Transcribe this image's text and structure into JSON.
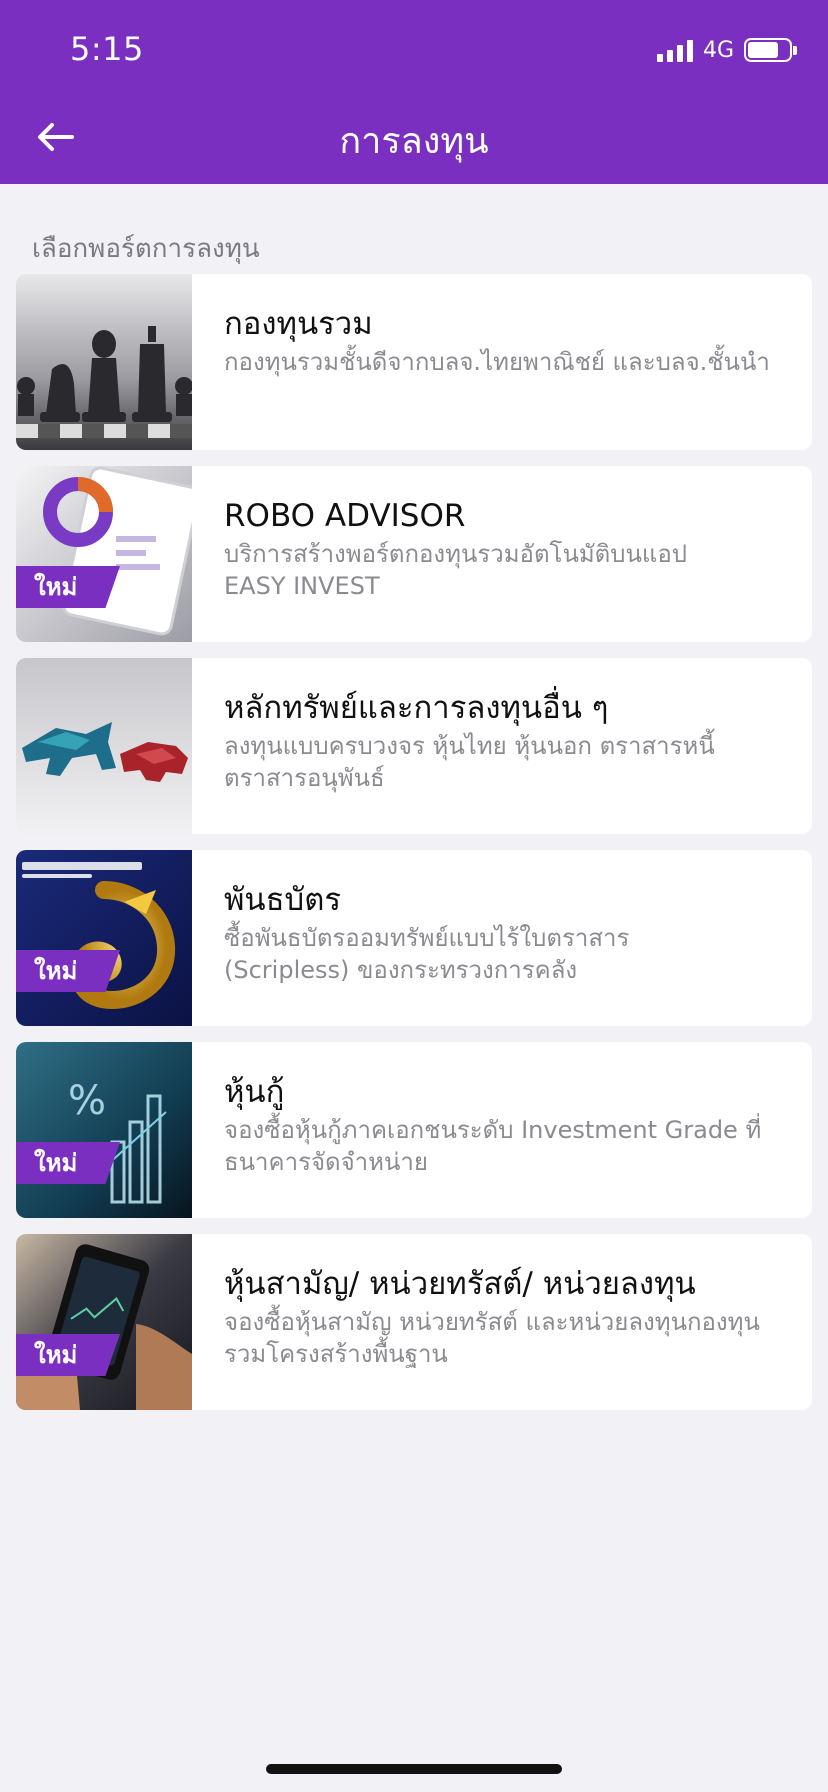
{
  "status_bar": {
    "time": "5:15",
    "network": "4G"
  },
  "header": {
    "title": "การลงทุน",
    "back_icon": "arrow-left-icon",
    "background_color": "#7b2fc0"
  },
  "section": {
    "label": "เลือกพอร์ตการลงทุน"
  },
  "badge_label": "ใหม่",
  "items": [
    {
      "title": "กองทุนรวม",
      "desc_line1": "กองทุนรวมชั้นดีจากบลจ.ไทยพาณิชย์ และบลจ.ชั้นนำ",
      "desc_line2": "",
      "image": "chess-pieces-image",
      "is_new": false
    },
    {
      "title": "ROBO ADVISOR",
      "desc_line1": "บริการสร้างพอร์ตกองทุนรวมอัตโนมัติบนแอป",
      "desc_line2": "EASY INVEST",
      "image": "tablet-chart-image",
      "is_new": true
    },
    {
      "title": "หลักทรัพย์และการลงทุนอื่น ๆ",
      "desc_line1": "ลงทุนแบบครบวงจร หุ้นไทย หุ้นนอก ตราสารหนี้",
      "desc_line2": "ตราสารอนุพันธ์",
      "image": "bull-bear-image",
      "is_new": false
    },
    {
      "title": "พันธบัตร",
      "desc_line1": "ซื้อพันธบัตรออมทรัพย์แบบไร้ใบตราสาร",
      "desc_line2": "(Scripless) ของกระทรวงการคลัง",
      "image": "government-bond-image",
      "is_new": true
    },
    {
      "title": "หุ้นกู้",
      "desc_line1": "จองซื้อหุ้นกู้ภาคเอกชนระดับ Investment Grade ที่",
      "desc_line2": "ธนาคารจัดจำหน่าย",
      "image": "percent-chart-image",
      "is_new": true
    },
    {
      "title": "หุ้นสามัญ/ หน่วยทรัสต์/ หน่วยลงทุน",
      "desc_line1": "จองซื้อหุ้นสามัญ หน่วยทรัสต์ และหน่วยลงทุนกองทุน",
      "desc_line2": "รวมโครงสร้างพื้นฐาน",
      "image": "phone-trading-image",
      "is_new": true
    }
  ]
}
